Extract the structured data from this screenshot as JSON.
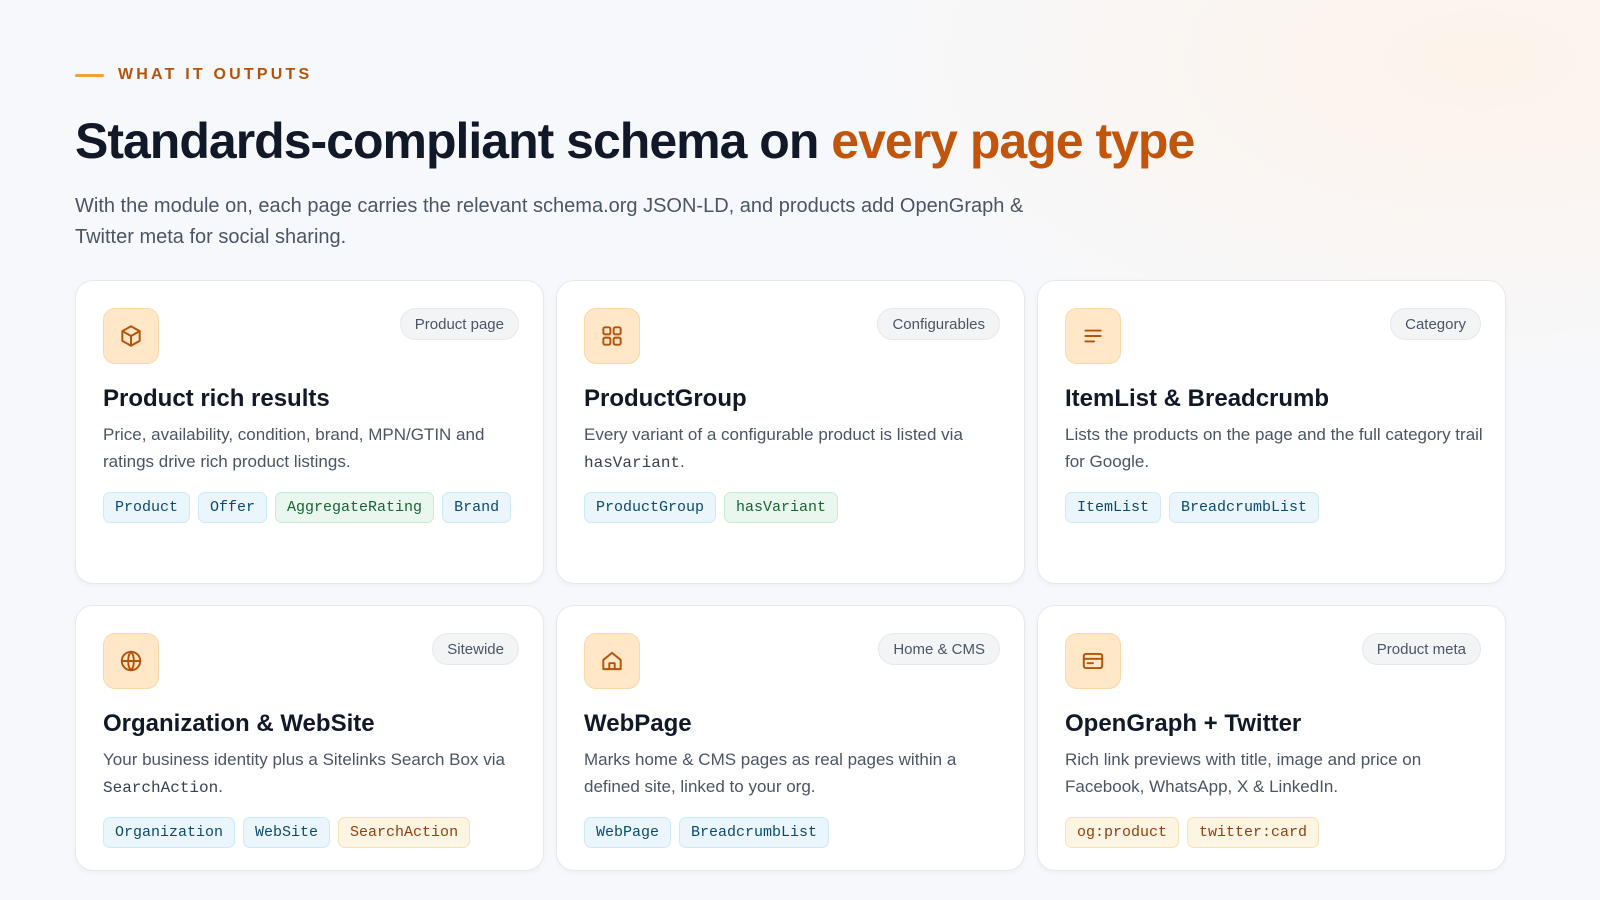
{
  "section": {
    "eyebrow": "WHAT IT OUTPUTS",
    "headline_main": "Standards-compliant schema on ",
    "headline_accent": "every page type",
    "lede": "With the module on, each page carries the relevant schema.org JSON-LD, and products add OpenGraph & Twitter meta for social sharing."
  },
  "cards": [
    {
      "icon": "cube-icon",
      "badge": "Product page",
      "title": "Product rich results",
      "desc": "Price, availability, condition, brand, MPN/GTIN and ratings drive rich product listings.",
      "tags": [
        {
          "label": "Product",
          "color": "blue"
        },
        {
          "label": "Offer",
          "color": "blue"
        },
        {
          "label": "AggregateRating",
          "color": "green"
        },
        {
          "label": "Brand",
          "color": "blue"
        }
      ]
    },
    {
      "icon": "grid-icon",
      "badge": "Configurables",
      "title": "ProductGroup",
      "desc_pre": "Every variant of a configurable product is listed via ",
      "desc_code": "hasVariant",
      "desc_post": ".",
      "tags": [
        {
          "label": "ProductGroup",
          "color": "blue"
        },
        {
          "label": "hasVariant",
          "color": "green"
        }
      ]
    },
    {
      "icon": "list-lines-icon",
      "badge": "Category",
      "title": "ItemList & Breadcrumb",
      "desc": "Lists the products on the page and the full category trail for Google.",
      "tags": [
        {
          "label": "ItemList",
          "color": "blue"
        },
        {
          "label": "BreadcrumbList",
          "color": "blue"
        }
      ]
    },
    {
      "icon": "globe-icon",
      "badge": "Sitewide",
      "title": "Organization & WebSite",
      "desc_pre": "Your business identity plus a Sitelinks Search Box via ",
      "desc_code": "SearchAction",
      "desc_post": ".",
      "tags": [
        {
          "label": "Organization",
          "color": "blue"
        },
        {
          "label": "WebSite",
          "color": "blue"
        },
        {
          "label": "SearchAction",
          "color": "amber"
        }
      ]
    },
    {
      "icon": "home-icon",
      "badge": "Home & CMS",
      "title": "WebPage",
      "desc": "Marks home & CMS pages as real pages within a defined site, linked to your org.",
      "tags": [
        {
          "label": "WebPage",
          "color": "blue"
        },
        {
          "label": "BreadcrumbList",
          "color": "blue"
        }
      ]
    },
    {
      "icon": "card-icon",
      "badge": "Product meta",
      "title": "OpenGraph + Twitter",
      "desc": "Rich link previews with title, image and price on Facebook, WhatsApp, X & LinkedIn.",
      "tags": [
        {
          "label": "og:product",
          "color": "amber"
        },
        {
          "label": "twitter:card",
          "color": "amber"
        }
      ]
    }
  ]
}
